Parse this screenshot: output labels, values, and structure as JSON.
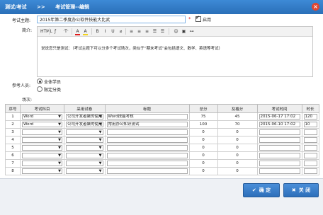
{
  "window": {
    "crumb1": "测试/考试",
    "sep": ">>",
    "crumb2": "考试管理--编辑",
    "close_glyph": "×"
  },
  "form": {
    "title_label": "考试主题:",
    "title_value": "2015年第二季度办公软件技能大比武",
    "required_mark": "*",
    "enable_label": "启用",
    "intro_label": "简介:",
    "intro_text": "说说您只是测试：（考试主题下可以分多个考试场次，类似于“期末考试”会包括语文、数学、英语等考试）",
    "participants_label": "参考人员:",
    "participants_options": [
      "全体学员",
      "限定分类"
    ],
    "sessions_label": "场次:"
  },
  "toolbar": {
    "items": [
      "HTML",
      "ƒ",
      "·T·",
      "A",
      "A",
      "B",
      "I",
      "U",
      "⌀",
      "≡",
      "≡",
      "≡",
      "☰",
      "☰",
      "☺",
      "▣",
      "⊶"
    ]
  },
  "table": {
    "headers": [
      "序号",
      "考试科目",
      "采用试卷",
      "标题",
      "总分",
      "及格分",
      "考试时间",
      "时长"
    ],
    "rows": [
      {
        "no": "1",
        "subject": "Word",
        "paper": "公司开发者聚的使用",
        "title": "Word技能考核",
        "total": "75",
        "pass": "45",
        "time": "2015-06-17 17:02",
        "dur": "120"
      },
      {
        "no": "2",
        "subject": "Word",
        "paper": "公司开发者聚的使用",
        "title": "常用办公知识测试",
        "total": "100",
        "pass": "70",
        "time": "2015-06-10 17:02",
        "dur": "10"
      },
      {
        "no": "3",
        "subject": "",
        "paper": "",
        "title": "",
        "total": "0",
        "pass": "0",
        "time": "",
        "dur": ""
      },
      {
        "no": "4",
        "subject": "",
        "paper": "",
        "title": "",
        "total": "0",
        "pass": "0",
        "time": "",
        "dur": ""
      },
      {
        "no": "5",
        "subject": "",
        "paper": "",
        "title": "",
        "total": "0",
        "pass": "0",
        "time": "",
        "dur": ""
      },
      {
        "no": "6",
        "subject": "",
        "paper": "",
        "title": "",
        "total": "0",
        "pass": "0",
        "time": "",
        "dur": ""
      },
      {
        "no": "7",
        "subject": "",
        "paper": "",
        "title": "",
        "total": "0",
        "pass": "0",
        "time": "",
        "dur": ""
      },
      {
        "no": "8",
        "subject": "",
        "paper": "",
        "title": "",
        "total": "0",
        "pass": "0",
        "time": "",
        "dur": ""
      }
    ]
  },
  "buttons": {
    "ok_icon": "✔",
    "ok": "确 定",
    "close_icon": "✖",
    "close": "关 闭"
  },
  "icons": {
    "dropdown": "▼"
  },
  "colors": {
    "titlebar": "#2a6fb8",
    "button": "#2d6fba",
    "close_button": "#e2452f",
    "required": "#e01b1b"
  }
}
